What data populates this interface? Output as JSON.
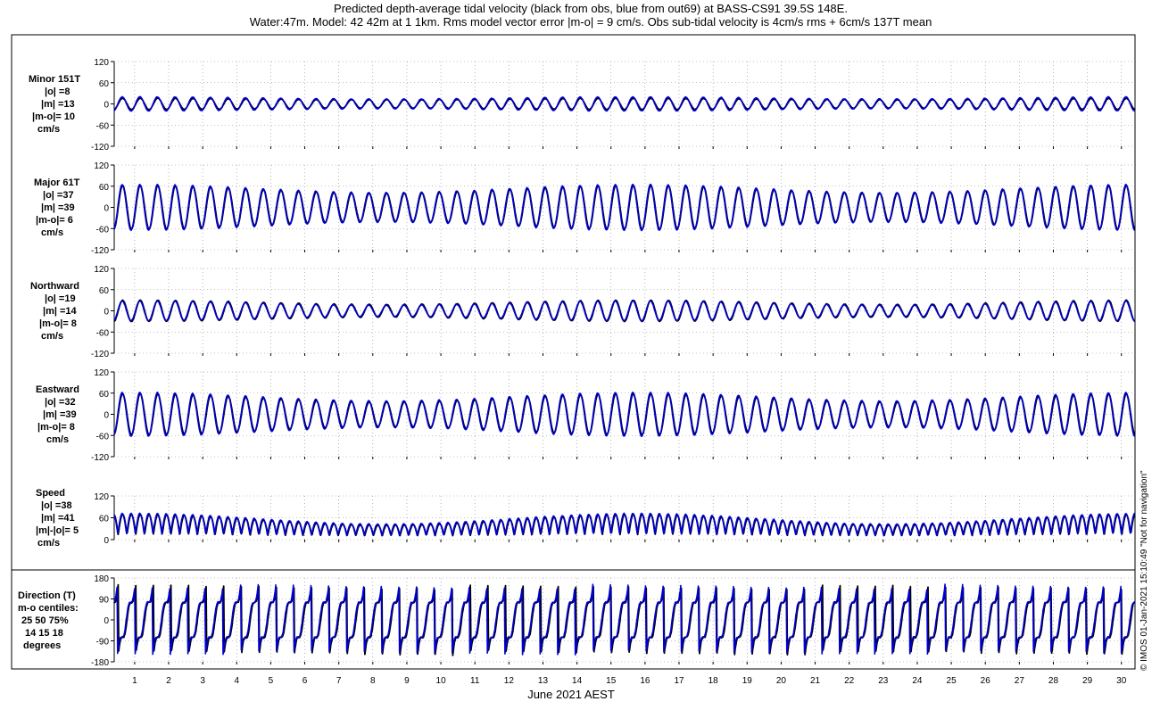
{
  "figure": {
    "title_line1": "Predicted depth-average tidal velocity (black from obs, blue from out69) at BASS-CS91 39.5S 148E.",
    "title_line2": "Water:47m. Model: 42 42m at 1 1km. Rms model vector error |m-o| = 9 cm/s. Obs sub-tidal velocity is 4cm/s rms + 6cm/s 137T mean",
    "watermark": "© IMOS 01-Jan-2021 15:10:49  \"Not for navigation\"",
    "xlabel": "June 2021 AEST",
    "colors": {
      "obs": "#000000",
      "model": "#0000d8"
    }
  },
  "panels": [
    {
      "id": "minor",
      "lines": [
        "Minor 151T",
        "|o| =8",
        "|m| =13",
        "|m-o|= 10",
        "cm/s"
      ]
    },
    {
      "id": "major",
      "lines": [
        "Major 61T",
        "|o| =37",
        "|m| =39",
        "|m-o|= 6",
        "cm/s"
      ]
    },
    {
      "id": "north",
      "lines": [
        "Northward",
        "|o| =19",
        "|m| =14",
        "|m-o|= 8",
        "cm/s"
      ]
    },
    {
      "id": "east",
      "lines": [
        "Eastward",
        "|o| =32",
        "|m| =39",
        "|m-o|= 8",
        "cm/s"
      ]
    },
    {
      "id": "speed",
      "lines": [
        "Speed",
        "|o| =38",
        "|m| =41",
        "|m|-|o|= 5",
        "cm/s"
      ]
    },
    {
      "id": "dir",
      "lines": [
        "Direction (T)",
        "m-o centiles:",
        "25  50  75%",
        "14  15  18",
        "degrees"
      ]
    }
  ],
  "chart_data": [
    {
      "type": "line",
      "panel": "minor",
      "ylabel": "",
      "ylim": [
        -120,
        120
      ],
      "yticks": [
        -120,
        -60,
        0,
        60,
        120
      ],
      "xlim": [
        0.4,
        30.4
      ],
      "xticks": [
        1,
        2,
        3,
        4,
        5,
        6,
        7,
        8,
        9,
        10,
        11,
        12,
        13,
        14,
        15,
        16,
        17,
        18,
        19,
        20,
        21,
        22,
        23,
        24,
        25,
        26,
        27,
        28,
        29,
        30
      ],
      "grid": true,
      "series": [
        {
          "name": "obs",
          "color": "#000000",
          "signal": "tidal",
          "amp_range": [
            12,
            16
          ]
        },
        {
          "name": "model",
          "color": "#0000d8",
          "signal": "tidal",
          "amp_range": [
            14,
            20
          ]
        }
      ]
    },
    {
      "type": "line",
      "panel": "major",
      "ylabel": "",
      "ylim": [
        -120,
        120
      ],
      "yticks": [
        -120,
        -60,
        0,
        60,
        120
      ],
      "xlim": [
        0.4,
        30.4
      ],
      "grid": true,
      "series": [
        {
          "name": "obs",
          "color": "#000000",
          "signal": "tidal",
          "amp_range": [
            40,
            62
          ]
        },
        {
          "name": "model",
          "color": "#0000d8",
          "signal": "tidal",
          "amp_range": [
            42,
            65
          ]
        }
      ]
    },
    {
      "type": "line",
      "panel": "north",
      "ylabel": "",
      "ylim": [
        -120,
        120
      ],
      "yticks": [
        -120,
        -60,
        0,
        60,
        120
      ],
      "xlim": [
        0.4,
        30.4
      ],
      "grid": true,
      "series": [
        {
          "name": "obs",
          "color": "#000000",
          "signal": "tidal",
          "amp_range": [
            18,
            30
          ]
        },
        {
          "name": "model",
          "color": "#0000d8",
          "signal": "tidal",
          "amp_range": [
            16,
            28
          ]
        }
      ]
    },
    {
      "type": "line",
      "panel": "east",
      "ylabel": "",
      "ylim": [
        -120,
        120
      ],
      "yticks": [
        -120,
        -60,
        0,
        60,
        120
      ],
      "xlim": [
        0.4,
        30.4
      ],
      "grid": true,
      "series": [
        {
          "name": "obs",
          "color": "#000000",
          "signal": "tidal",
          "amp_range": [
            35,
            58
          ]
        },
        {
          "name": "model",
          "color": "#0000d8",
          "signal": "tidal",
          "amp_range": [
            38,
            62
          ]
        }
      ]
    },
    {
      "type": "line",
      "panel": "speed",
      "ylabel": "",
      "ylim": [
        0,
        120
      ],
      "yticks": [
        0,
        60,
        120
      ],
      "xlim": [
        0.4,
        30.4
      ],
      "grid": true,
      "series": [
        {
          "name": "obs",
          "color": "#000000",
          "signal": "speed",
          "amp_range": [
            35,
            65
          ]
        },
        {
          "name": "model",
          "color": "#0000d8",
          "signal": "speed",
          "amp_range": [
            38,
            68
          ]
        }
      ]
    },
    {
      "type": "line",
      "panel": "dir",
      "ylabel": "",
      "ylim": [
        -180,
        180
      ],
      "yticks": [
        -180,
        -90,
        0,
        90,
        180
      ],
      "xlim": [
        0.4,
        30.4
      ],
      "grid": true,
      "series": [
        {
          "name": "obs",
          "color": "#000000",
          "signal": "direction"
        },
        {
          "name": "model",
          "color": "#0000d8",
          "signal": "direction"
        }
      ]
    }
  ]
}
